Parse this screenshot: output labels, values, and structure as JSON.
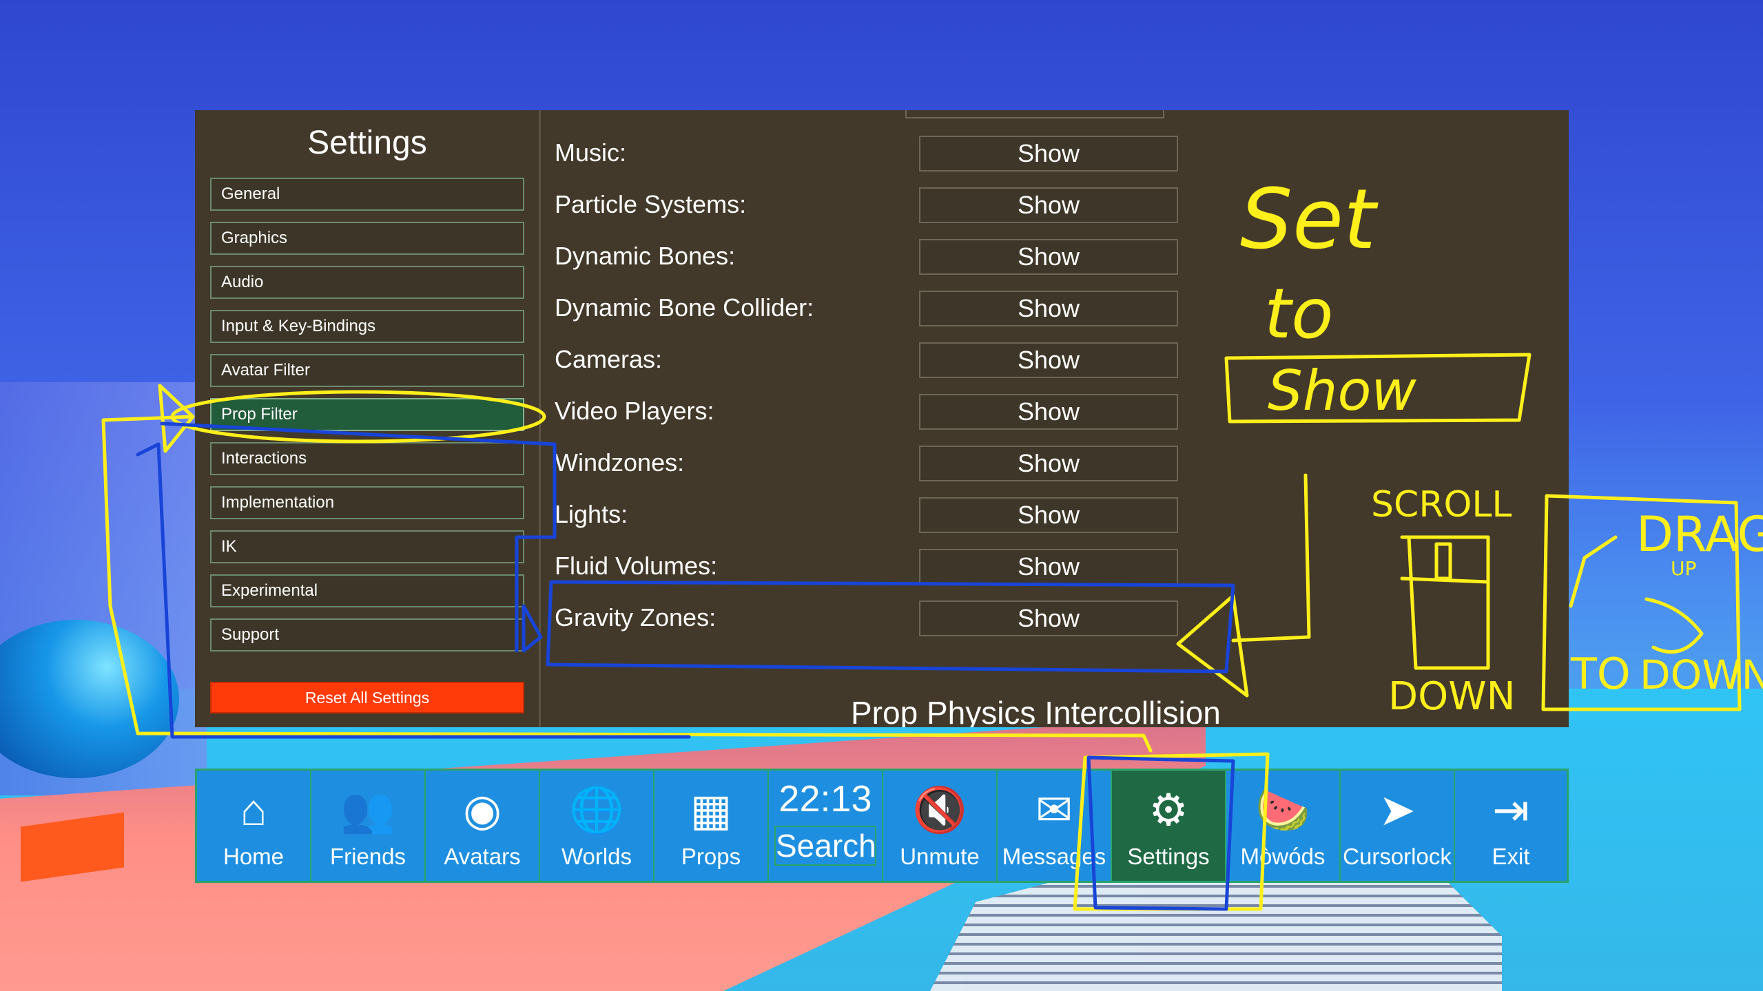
{
  "settings": {
    "title": "Settings",
    "nav": [
      {
        "label": "General"
      },
      {
        "label": "Graphics"
      },
      {
        "label": "Audio"
      },
      {
        "label": "Input & Key-Bindings"
      },
      {
        "label": "Avatar Filter"
      },
      {
        "label": "Prop Filter",
        "active": true
      },
      {
        "label": "Interactions"
      },
      {
        "label": "Implementation"
      },
      {
        "label": "IK"
      },
      {
        "label": "Experimental"
      },
      {
        "label": "Support"
      }
    ],
    "reset_label": "Reset All Settings",
    "rows": [
      {
        "label": "Music:",
        "value": "Show"
      },
      {
        "label": "Particle Systems:",
        "value": "Show"
      },
      {
        "label": "Dynamic Bones:",
        "value": "Show"
      },
      {
        "label": "Dynamic Bone Collider:",
        "value": "Show"
      },
      {
        "label": "Cameras:",
        "value": "Show"
      },
      {
        "label": "Video Players:",
        "value": "Show"
      },
      {
        "label": "Windzones:",
        "value": "Show"
      },
      {
        "label": "Lights:",
        "value": "Show"
      },
      {
        "label": "Fluid Volumes:",
        "value": "Show"
      },
      {
        "label": "Gravity Zones:",
        "value": "Show"
      }
    ],
    "section_heading": "Prop Physics Intercollision"
  },
  "menu": {
    "items": [
      {
        "label": "Home",
        "icon": "home-icon"
      },
      {
        "label": "Friends",
        "icon": "friends-icon"
      },
      {
        "label": "Avatars",
        "icon": "avatar-icon"
      },
      {
        "label": "Worlds",
        "icon": "globe-icon"
      },
      {
        "label": "Props",
        "icon": "cube-icon"
      },
      {
        "label": "Search",
        "icon": "search"
      },
      {
        "label": "Unmute",
        "icon": "speaker-muted-icon"
      },
      {
        "label": "Messages",
        "icon": "envelope-icon"
      },
      {
        "label": "Settings",
        "icon": "gear-icon",
        "active": true
      },
      {
        "label": "Mòwóds",
        "icon": "watermelon-icon"
      },
      {
        "label": "Cursorlock",
        "icon": "cursor-icon"
      },
      {
        "label": "Exit",
        "icon": "exit-icon"
      }
    ],
    "clock": "22:13"
  },
  "annotations": {
    "set_to_line1": "Set",
    "set_to_line2": "to",
    "show_box": "Show",
    "scroll": "SCROLL",
    "down": "DOWN",
    "drag": "DRAG",
    "up": "UP",
    "to": "TO",
    "down2": "DOWN",
    "colors": {
      "yellow": "#ffef1a",
      "blue": "#1844d8"
    }
  }
}
